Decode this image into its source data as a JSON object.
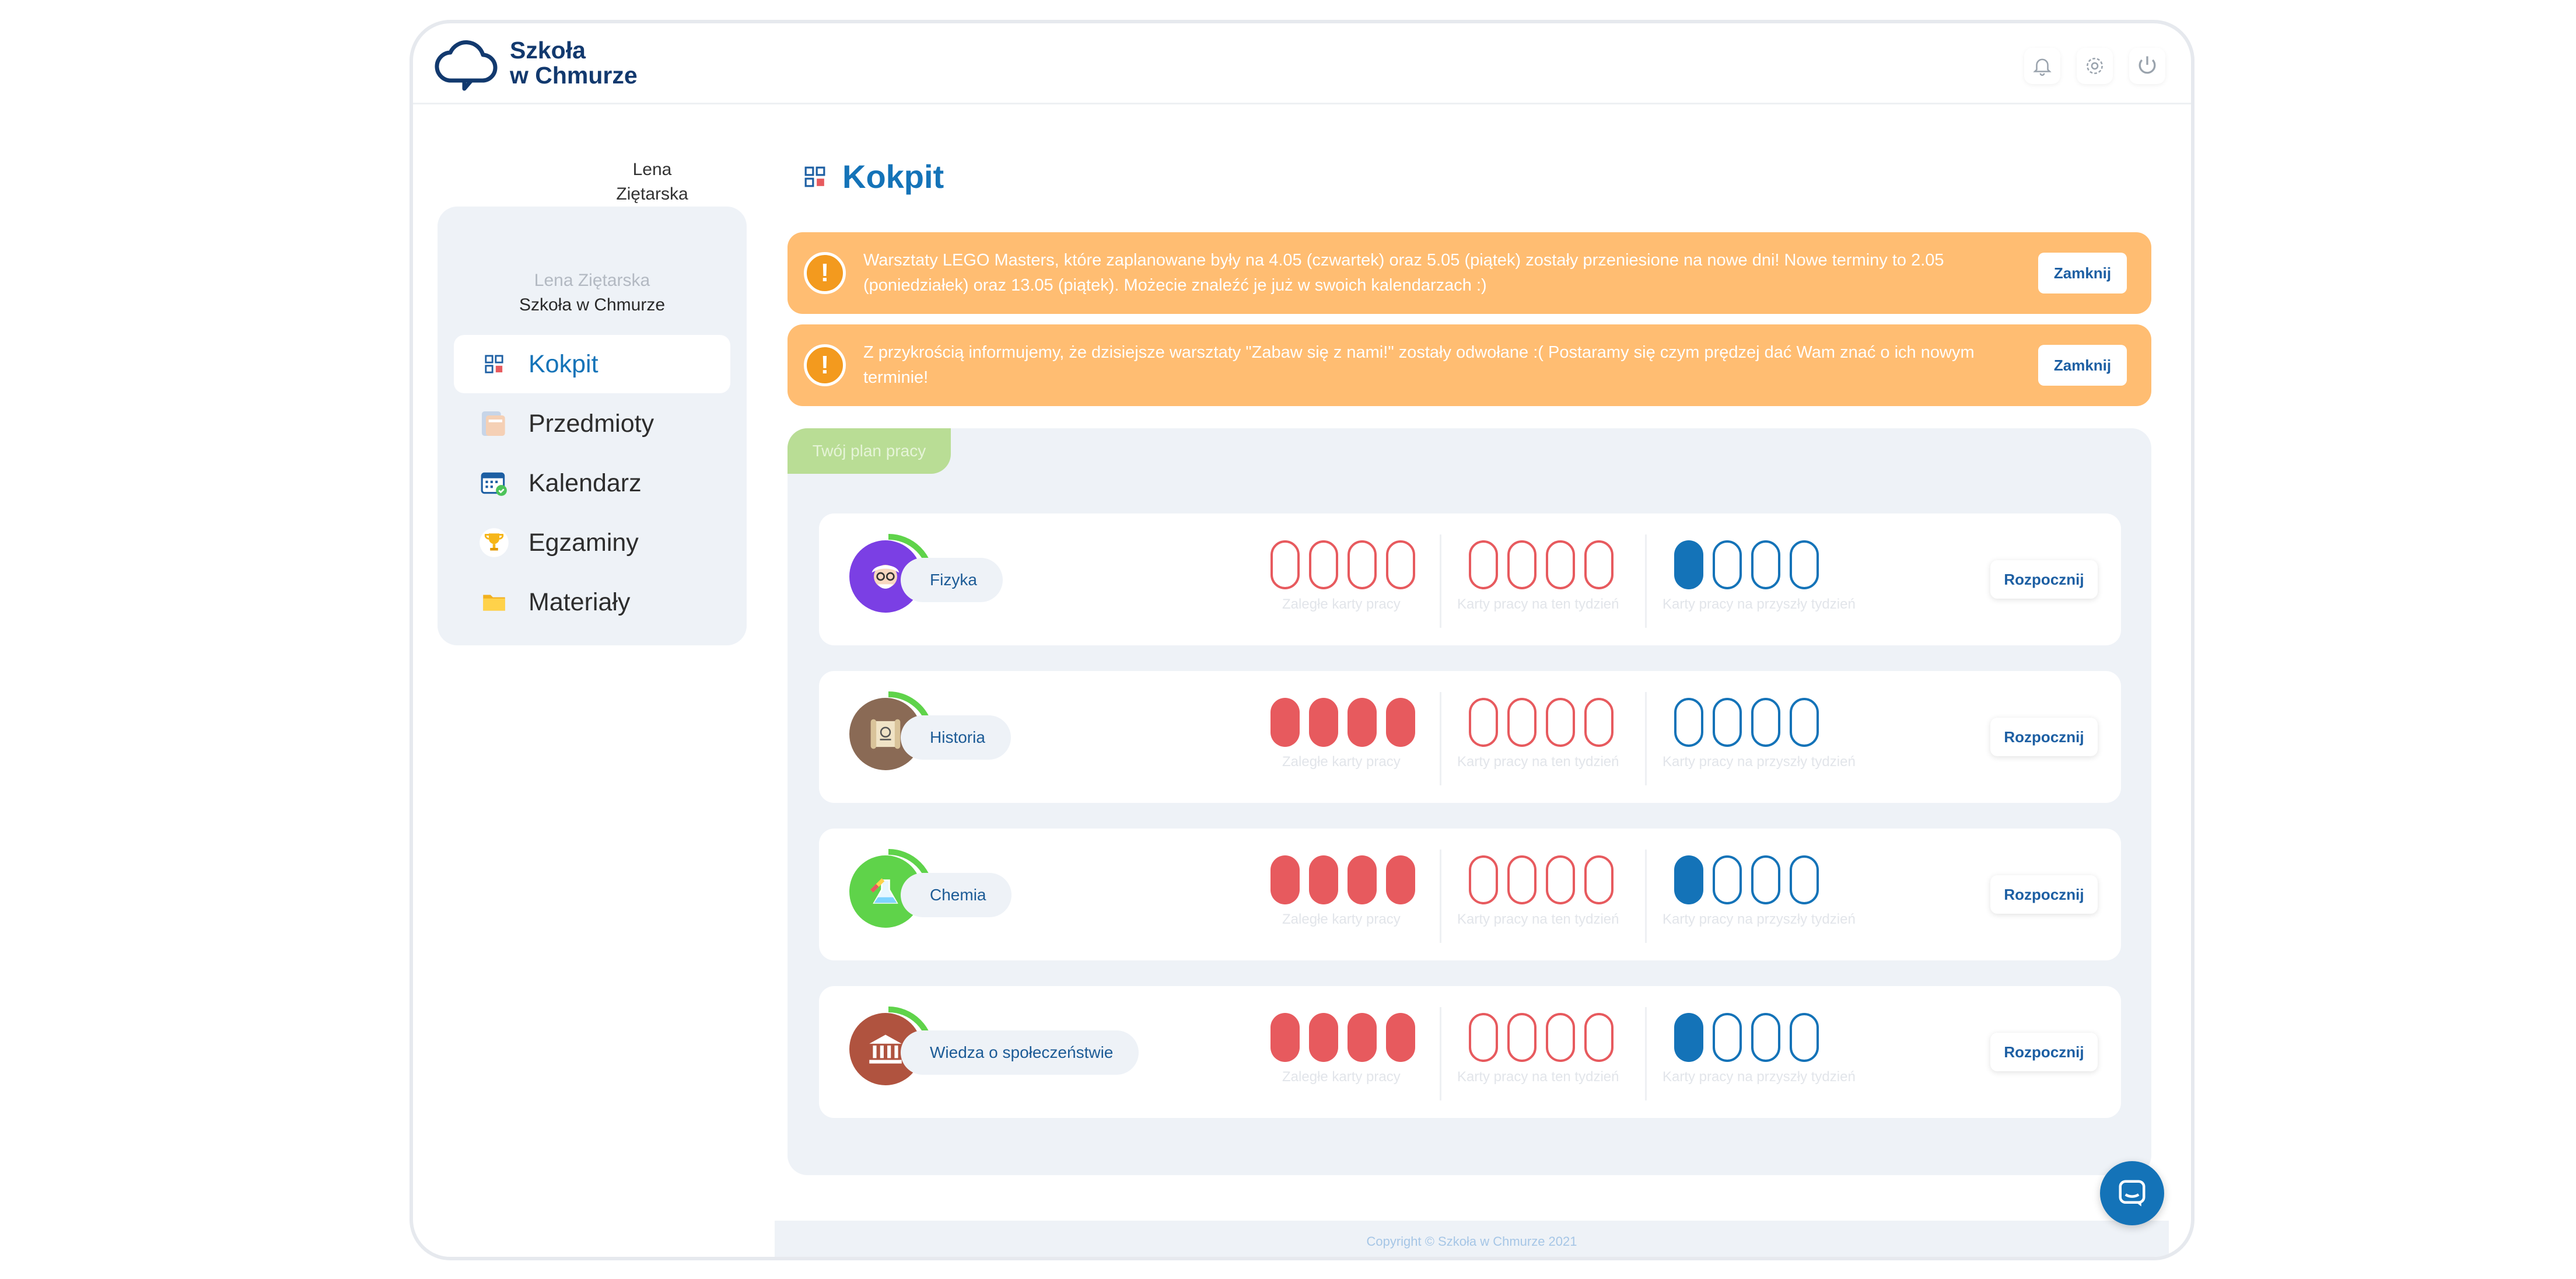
{
  "app": {
    "logo_line1": "Szkoła",
    "logo_line2": "w Chmurze"
  },
  "header_icons": [
    "bell-icon",
    "gear-icon",
    "power-icon"
  ],
  "user": {
    "first_name": "Lena",
    "last_name": "Ziętarska",
    "full_name": "Lena Ziętarska",
    "school": "Szkoła w Chmurze"
  },
  "sidebar": {
    "items": [
      {
        "label": "Kokpit",
        "icon": "dashboard-icon",
        "active": true
      },
      {
        "label": "Przedmioty",
        "icon": "books-icon",
        "active": false
      },
      {
        "label": "Kalendarz",
        "icon": "calendar-icon",
        "active": false
      },
      {
        "label": "Egzaminy",
        "icon": "trophy-icon",
        "active": false
      },
      {
        "label": "Materiały",
        "icon": "folder-icon",
        "active": false
      }
    ]
  },
  "page": {
    "title": "Kokpit"
  },
  "alerts": [
    {
      "text": "Warsztaty LEGO Masters, które zaplanowane były na 4.05 (czwartek) oraz 5.05 (piątek) zostały przeniesione na nowe dni! Nowe terminy to 2.05 (poniedziałek) oraz 13.05 (piątek). Możecie znaleźć je już w swoich kalendarzach :)",
      "button": "Zamknij"
    },
    {
      "text": "Z przykrością informujemy, że dzisiejsze warsztaty \"Zabaw się z nami!\" zostały odwołane :( Postaramy się czym prędzej dać Wam znać o ich nowym terminie!",
      "button": "Zamknij"
    }
  ],
  "plan": {
    "tab_label": "Twój plan pracy",
    "captions": {
      "overdue": "Zaległe karty pracy",
      "this_week": "Karty pracy na ten tydzień",
      "next_week": "Karty pracy na przyszły tydzień"
    },
    "start_label": "Rozpocznij",
    "subjects": [
      {
        "name": "Fizyka",
        "avatar_color": "#7b3fe4",
        "progress": 0.25,
        "overdue_done": 0,
        "this_week_done": 0,
        "next_week_done": 1
      },
      {
        "name": "Historia",
        "avatar_color": "#8a6a55",
        "progress": 0.2,
        "overdue_done": 4,
        "this_week_done": 0,
        "next_week_done": 0
      },
      {
        "name": "Chemia",
        "avatar_color": "#5fd34a",
        "progress": 0.25,
        "overdue_done": 4,
        "this_week_done": 0,
        "next_week_done": 1
      },
      {
        "name": "Wiedza o społeczeństwie",
        "avatar_color": "#b0533f",
        "progress": 0.25,
        "overdue_done": 4,
        "this_week_done": 0,
        "next_week_done": 1
      }
    ]
  },
  "footer": {
    "copyright": "Copyright © Szkoła w Chmurze 2021"
  },
  "colors": {
    "primary": "#1473b8",
    "alert": "#ffbd72",
    "overdue": "#e75a5e",
    "plan_tab": "#b9dd95"
  }
}
